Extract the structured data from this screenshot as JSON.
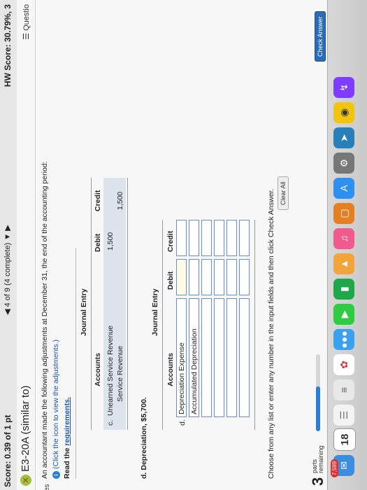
{
  "header": {
    "score": "Score: 0.39 of 1 pt",
    "pager": "4 of 9 (4 complete)",
    "hw_score": "HW Score: 30.79%, 3",
    "question_title": "E3-20A (similar to)",
    "questions_label": "Questio"
  },
  "intro": {
    "text": "An accountant made the following adjustments at December 31, the end of the accounting period:",
    "info_link": "(Click the icon to view the adjustments.)",
    "read_label": "Read the ",
    "requirements_link": "requirements."
  },
  "entry_c": {
    "title": "Journal Entry",
    "headers": {
      "accounts": "Accounts",
      "debit": "Debit",
      "credit": "Credit"
    },
    "letter": "c.",
    "rows": [
      {
        "account": "Unearned Service Revenue",
        "debit": "1,500",
        "credit": ""
      },
      {
        "account": "Service Revenue",
        "debit": "",
        "credit": "1,500"
      }
    ]
  },
  "entry_d": {
    "prompt": "d. Depreciation, $5,700.",
    "title": "Journal Entry",
    "headers": {
      "accounts": "Accounts",
      "debit": "Debit",
      "credit": "Credit"
    },
    "letter": "d.",
    "rows": [
      {
        "account": "Depreciation Expense",
        "debit": "",
        "credit": ""
      },
      {
        "account": "Accumulated Depreciation",
        "debit": "",
        "credit": ""
      }
    ]
  },
  "footer": {
    "instruction": "Choose from any list or enter any number in the input fields and then click Check Answer.",
    "parts_count": "3",
    "parts_label_1": "parts",
    "parts_label_2": "remaining",
    "progress": 0.58,
    "clear_all": "Clear All",
    "check_answer": "Check Answer"
  },
  "side_label": "es",
  "dock": {
    "calendar_day": "18",
    "mail_badge": "7,599"
  }
}
